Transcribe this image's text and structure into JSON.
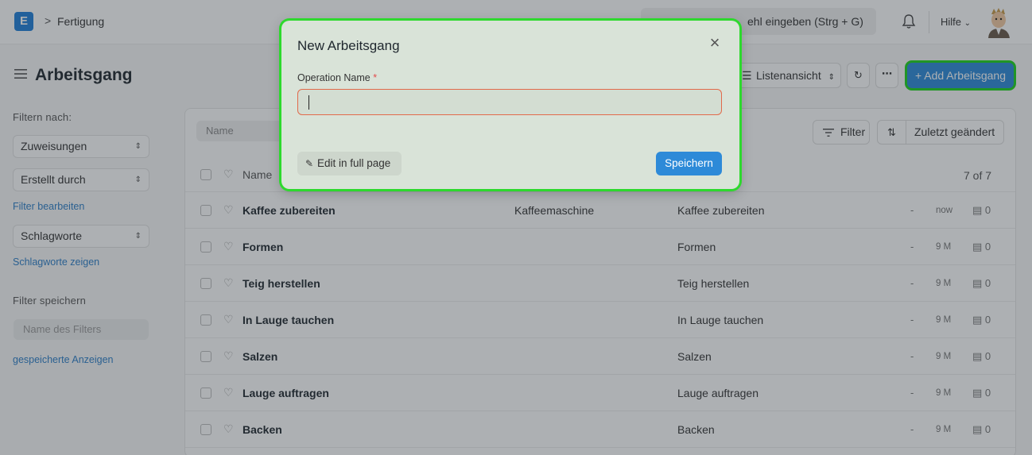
{
  "navbar": {
    "app_logo_letter": "E",
    "breadcrumb_sep": ">",
    "breadcrumb": "Fertigung",
    "search_text": "ehl eingeben (Strg + G)",
    "help_label": "Hilfe"
  },
  "page": {
    "title": "Arbeitsgang",
    "view_label": "Listenansicht",
    "add_button_label": "+ Add Arbeitsgang"
  },
  "sidebar": {
    "filter_by_label": "Filtern nach:",
    "assigned_label": "Zuweisungen",
    "created_by_label": "Erstellt durch",
    "edit_filters_link": "Filter bearbeiten",
    "tags_label": "Schlagworte",
    "show_tags_link": "Schlagworte zeigen",
    "save_filter_label": "Filter speichern",
    "filter_name_placeholder": "Name des Filters",
    "saved_reports_link": "gespeicherte Anzeigen"
  },
  "list": {
    "name_filter_placeholder": "Name",
    "filter_button": "Filter",
    "sort_label": "Zuletzt geändert",
    "header_name": "Name",
    "count": "7 of 7",
    "rows": [
      {
        "name": "Kaffee zubereiten",
        "workstation": "Kaffeemaschine",
        "description": "Kaffee zubereiten",
        "dash": "-",
        "time": "now",
        "comments": "0"
      },
      {
        "name": "Formen",
        "workstation": "",
        "description": "Formen",
        "dash": "-",
        "time": "9 M",
        "comments": "0"
      },
      {
        "name": "Teig herstellen",
        "workstation": "",
        "description": "Teig herstellen",
        "dash": "-",
        "time": "9 M",
        "comments": "0"
      },
      {
        "name": "In Lauge tauchen",
        "workstation": "",
        "description": "In Lauge tauchen",
        "dash": "-",
        "time": "9 M",
        "comments": "0"
      },
      {
        "name": "Salzen",
        "workstation": "",
        "description": "Salzen",
        "dash": "-",
        "time": "9 M",
        "comments": "0"
      },
      {
        "name": "Lauge auftragen",
        "workstation": "",
        "description": "Lauge auftragen",
        "dash": "-",
        "time": "9 M",
        "comments": "0"
      },
      {
        "name": "Backen",
        "workstation": "",
        "description": "Backen",
        "dash": "-",
        "time": "9 M",
        "comments": "0"
      }
    ]
  },
  "modal": {
    "title": "New Arbeitsgang",
    "field_label": "Operation Name",
    "required_mark": "*",
    "field_value": "",
    "edit_full_page": "Edit in full page",
    "save_button": "Speichern"
  },
  "colors": {
    "primary": "#2d8ad8",
    "highlight": "#2dd92d",
    "required": "#e24c4c"
  }
}
